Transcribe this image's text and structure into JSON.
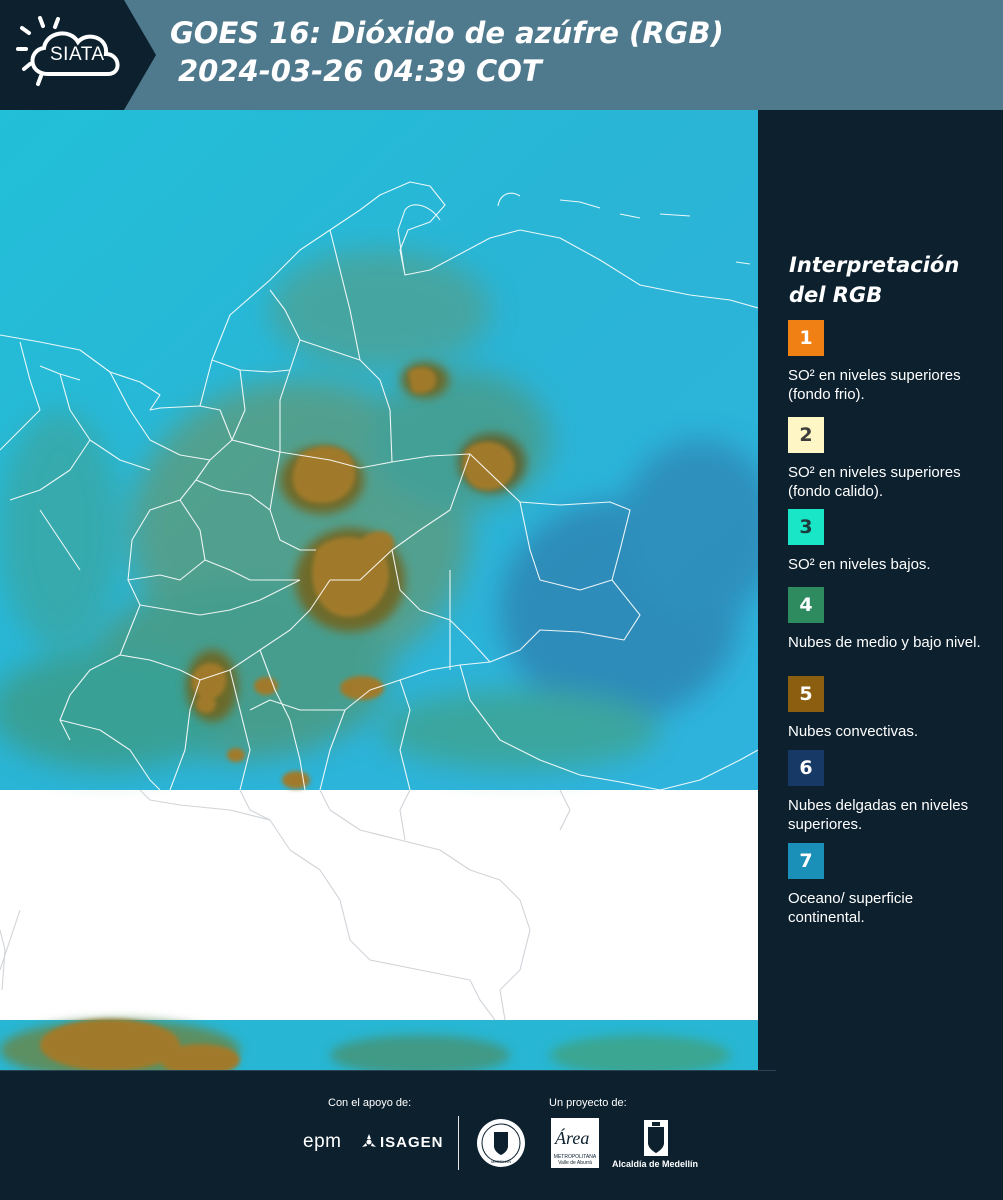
{
  "header": {
    "logo_text": "SIATA",
    "title_line1": "GOES 16: Dióxido de azúfre (RGB)",
    "title_line2": "2024-03-26 04:39 COT"
  },
  "legend": {
    "title": "Interpretación del RGB",
    "items": [
      {
        "number": "1",
        "label": "SO² en niveles superiores (fondo frio).",
        "color": "#f07f14",
        "text_color": "#ffffff"
      },
      {
        "number": "2",
        "label": "SO² en niveles superiores (fondo calido).",
        "color": "#fef6c4",
        "text_color": "#3c3c3c"
      },
      {
        "number": "3",
        "label": "SO² en niveles bajos.",
        "color": "#19e6c6",
        "text_color": "#1c3a3a"
      },
      {
        "number": "4",
        "label": "Nubes de medio y bajo nivel.",
        "color": "#2e8a5f",
        "text_color": "#ffffff"
      },
      {
        "number": "5",
        "label": "Nubes convectivas.",
        "color": "#8c5e0f",
        "text_color": "#ffffff"
      },
      {
        "number": "6",
        "label": "Nubes delgadas en niveles superiores.",
        "color": "#173966",
        "text_color": "#ffffff"
      },
      {
        "number": "7",
        "label": "Oceano/ superficie continental.",
        "color": "#1a8fb8",
        "text_color": "#ffffff"
      }
    ]
  },
  "footer": {
    "support_caption": "Con el apoyo de:",
    "project_caption": "Un proyecto de:",
    "epm": "epm",
    "isagen": "ISAGEN",
    "seal_text": "MEDELLIN",
    "area_word": "Área",
    "area_line1": "METROPOLITANA",
    "area_line2": "Valle de Aburrá",
    "alcaldia": "Alcaldía de Medellín"
  },
  "colors": {
    "background": "#0c202e",
    "header_band": "#4f7a8e",
    "cyan_surface": "#1fb7cf",
    "convective": "#8c6a1e"
  }
}
